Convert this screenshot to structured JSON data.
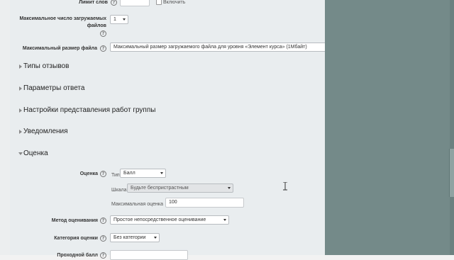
{
  "form": {
    "word_limit": {
      "label": "Лимит слов",
      "value": "",
      "enable_label": "Включить",
      "enabled": false
    },
    "max_files": {
      "label_line1": "Максимальное число загружаемых",
      "label_line2": "файлов",
      "value": "1"
    },
    "max_file_size": {
      "label": "Максимальный размер файла",
      "value": "Максимальный размер загружаемого файла для уровня «Элемент курса» (1Мбайт)"
    }
  },
  "sections": [
    {
      "title": "Типы отзывов",
      "expanded": false
    },
    {
      "title": "Параметры ответа",
      "expanded": false
    },
    {
      "title": "Настройки представления работ группы",
      "expanded": false
    },
    {
      "title": "Уведомления",
      "expanded": false
    },
    {
      "title": "Оценка",
      "expanded": true
    }
  ],
  "grade": {
    "label": "Оценка",
    "type_label": "Тип",
    "type_value": "Балл",
    "scale_label": "Шкала",
    "scale_value": "Будьте беспристрастным",
    "max_grade_label": "Максимальная оценка",
    "max_grade_value": "100"
  },
  "grading_method": {
    "label": "Метод оценивания",
    "value": "Простое непосредственное оценивание"
  },
  "grade_category": {
    "label": "Категория оценки",
    "value": "Без категории"
  },
  "passing_grade": {
    "label": "Проходной балл"
  },
  "colors": {
    "panel": "#e9edef",
    "sidebar": "#748a89"
  }
}
